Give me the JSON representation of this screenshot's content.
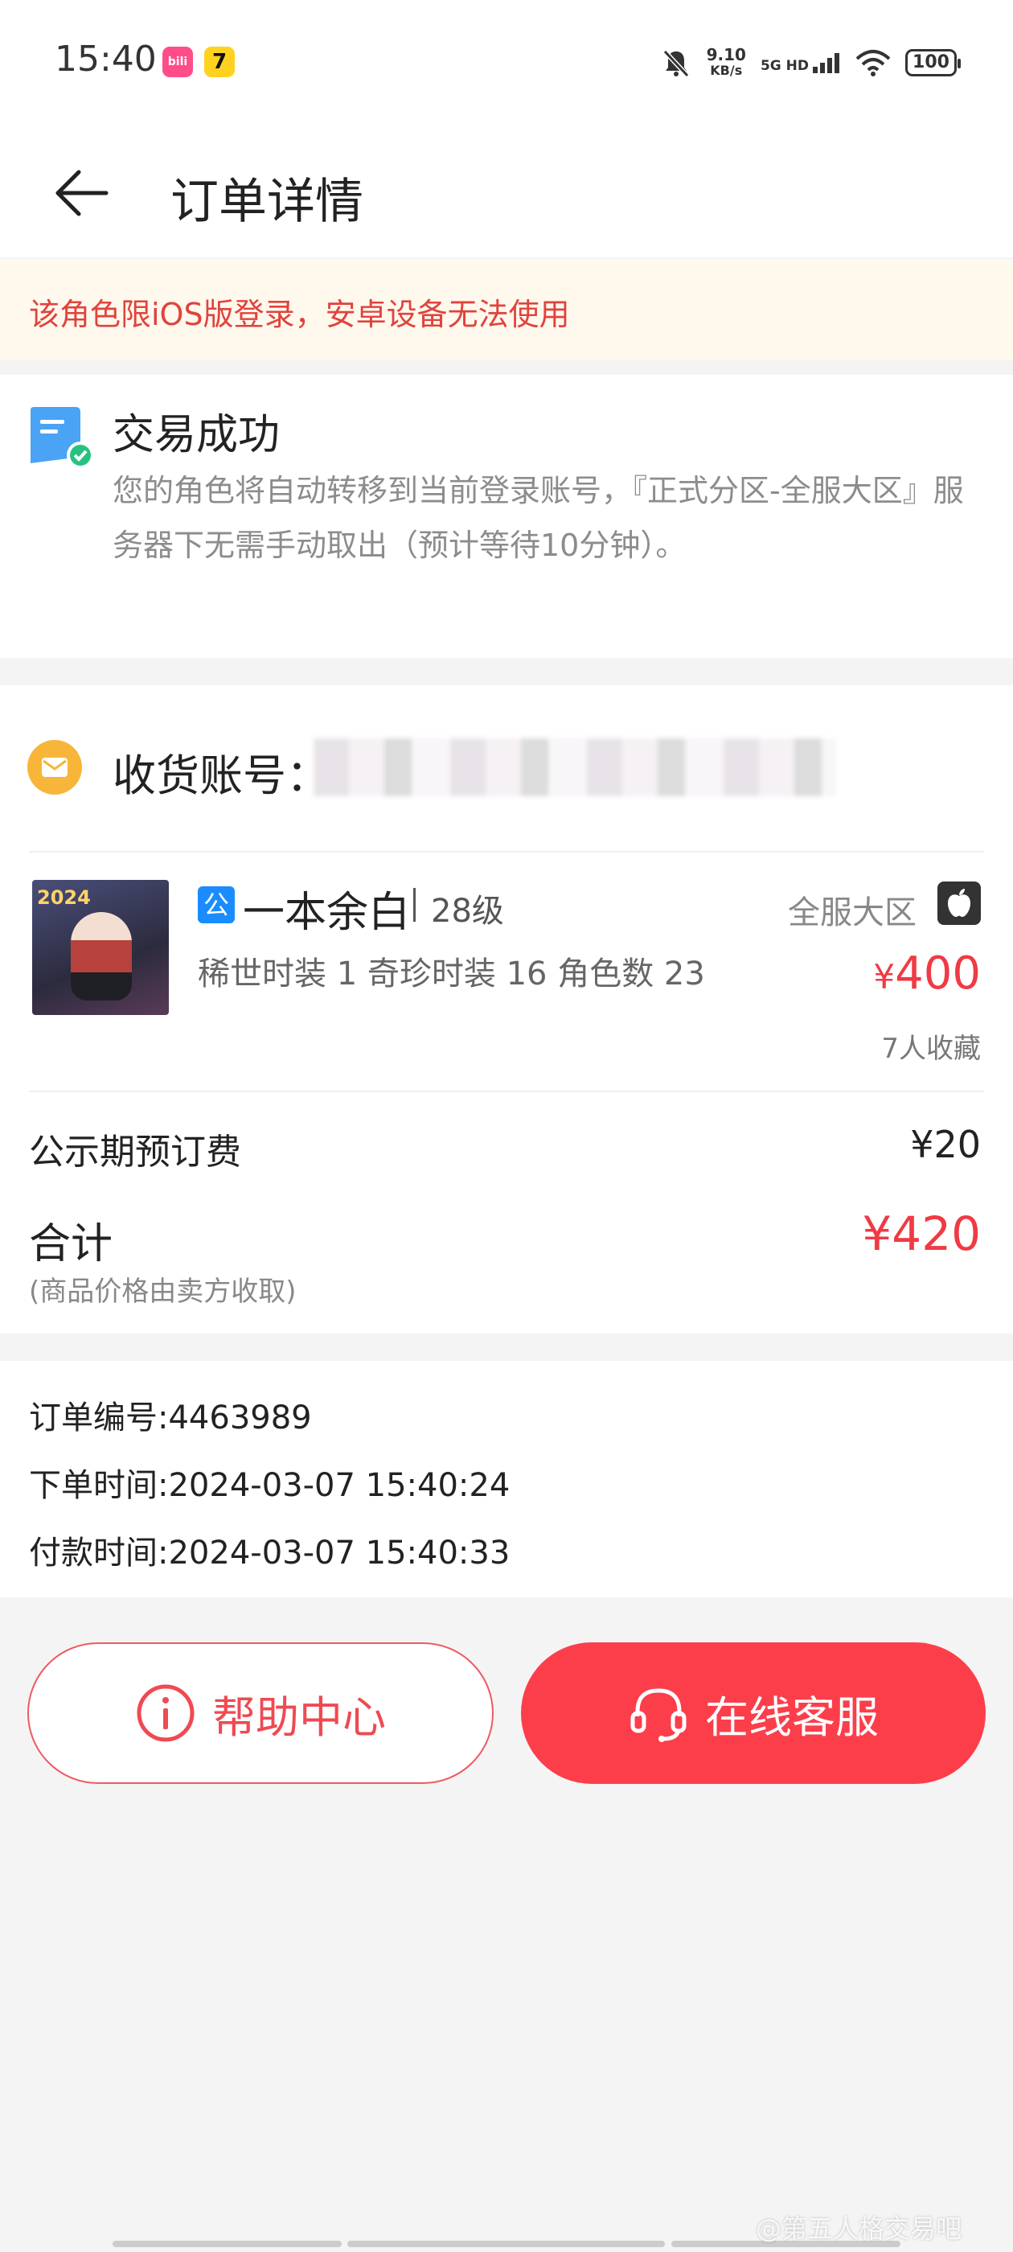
{
  "status_bar": {
    "time": "15:40",
    "speed_value": "9.10",
    "speed_unit": "KB/s",
    "network": "5G HD",
    "battery": "100"
  },
  "header": {
    "title": "订单详情"
  },
  "warning": {
    "text": "该角色限iOS版登录，安卓设备无法使用"
  },
  "status": {
    "title": "交易成功",
    "description": "您的角色将自动转移到当前登录账号，『正式分区-全服大区』服务器下无需手动取出（预计等待10分钟）。"
  },
  "order": {
    "account_label": "收货账号：",
    "account_value": "",
    "thumb_year": "2024",
    "badge": "公",
    "role_name": "一本余白",
    "role_level": "28级",
    "server": "全服大区",
    "tags": "稀世时装 1 奇珍时装 16 角色数 23",
    "price_symbol": "¥",
    "price": "400",
    "favorites": "7人收藏",
    "fee_label": "公示期预订费",
    "fee_value": "¥20",
    "total_label": "合计",
    "total_value": "¥420",
    "total_note": "(商品价格由卖方收取)"
  },
  "info": {
    "order_no": "订单编号:4463989",
    "order_time": "下单时间:2024-03-07 15:40:24",
    "pay_time": "付款时间:2024-03-07 15:40:33"
  },
  "buttons": {
    "help": "帮助中心",
    "service": "在线客服"
  },
  "watermark": "@第五人格交易吧",
  "colors": {
    "accent": "#fc3e4b",
    "warning_text": "#e0433d",
    "warning_bg": "#fff8ed"
  }
}
